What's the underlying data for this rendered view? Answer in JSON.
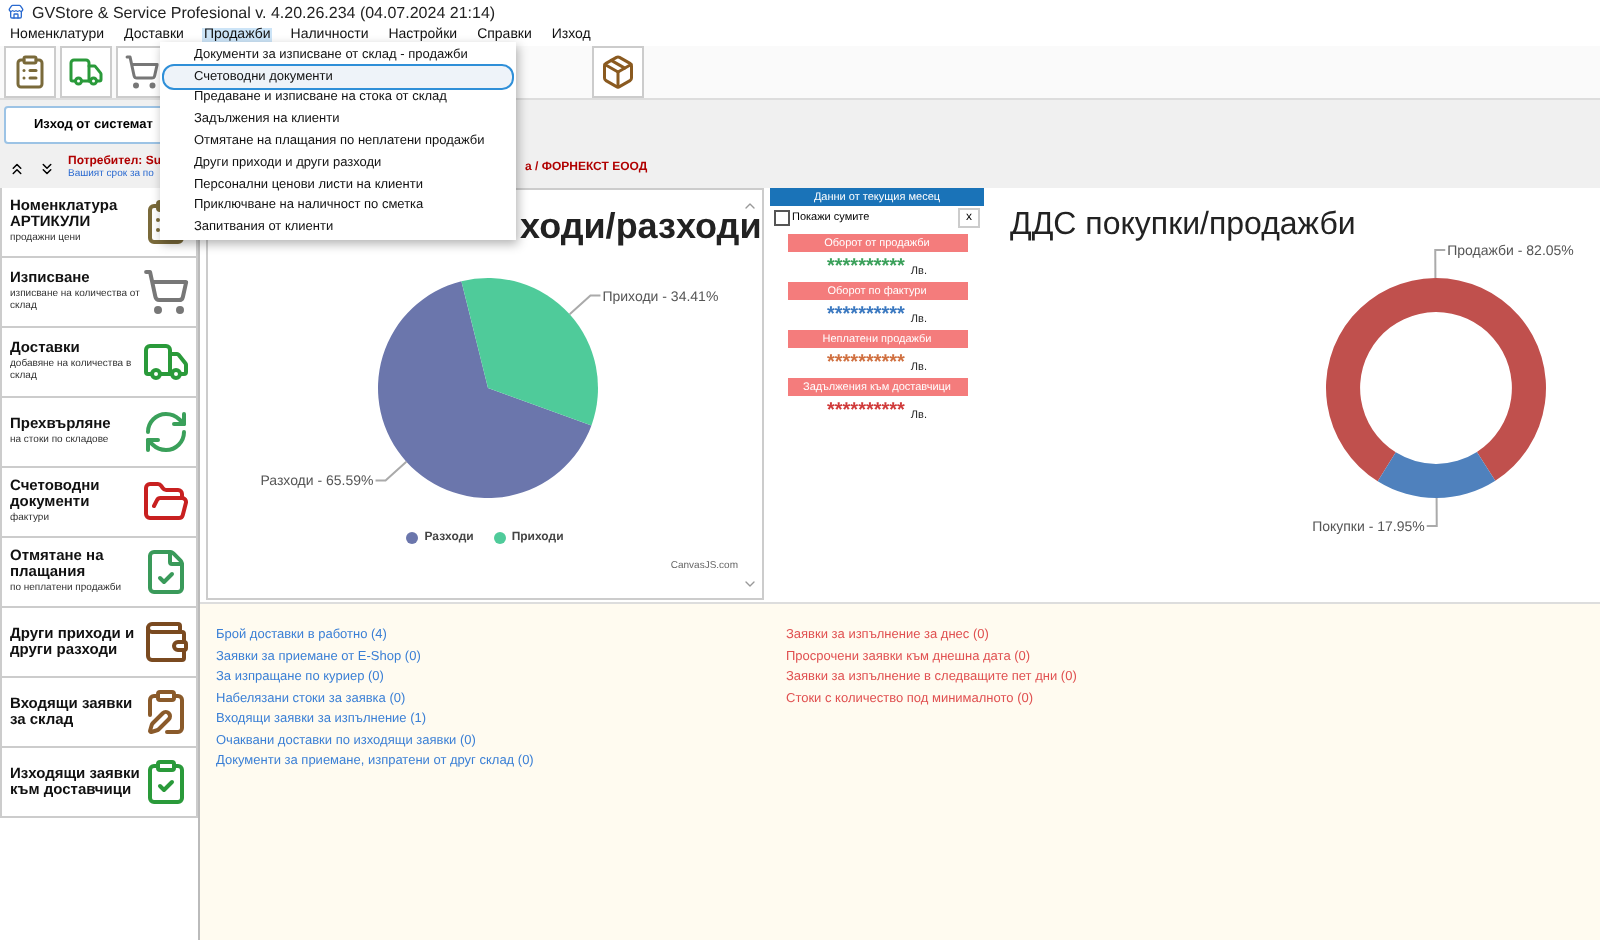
{
  "window": {
    "title": "GVStore & Service Profesional v. 4.20.26.234 (04.07.2024 21:14)"
  },
  "menu": [
    {
      "label": "Номенклатури",
      "selected": false
    },
    {
      "label": "Доставки",
      "selected": false
    },
    {
      "label": "Продажби",
      "selected": true
    },
    {
      "label": "Наличности",
      "selected": false
    },
    {
      "label": "Настройки",
      "selected": false
    },
    {
      "label": "Справки",
      "selected": false
    },
    {
      "label": "Изход",
      "selected": false
    }
  ],
  "dropdown": [
    {
      "label": "Документи за изписване от склад - продажби",
      "selected": false
    },
    {
      "label": "Счетоводни документи",
      "selected": true
    },
    {
      "label": "Предаване и изписване на стока от склад",
      "selected": false
    },
    {
      "label": "Задължения на клиенти",
      "selected": false
    },
    {
      "label": "Отмятане на плащания по неплатени продажби",
      "selected": false
    },
    {
      "label": "Други приходи и други разходи",
      "selected": false
    },
    {
      "label": "Персонални ценови листи на клиенти",
      "selected": false
    },
    {
      "label": "Приключване на наличност по сметка",
      "selected": false
    },
    {
      "label": "Запитвания от клиенти",
      "selected": false
    }
  ],
  "exit_button": "Изход от системат",
  "info": {
    "user": "Потребител: Su",
    "term": "Вашият срок за по",
    "company": "а / ФОРНЕКСТ ЕООД"
  },
  "sidebar": [
    {
      "title": "Номенклатура АРТИКУЛИ",
      "subtitle": "продажни цени"
    },
    {
      "title": "Изписване",
      "subtitle": "изписване на количества от склад"
    },
    {
      "title": "Доставки",
      "subtitle": "добавяне на количества в склад"
    },
    {
      "title": "Прехвърляне",
      "subtitle": "на стоки по складове"
    },
    {
      "title": "Счетоводни документи",
      "subtitle": "фактури"
    },
    {
      "title": "Отмятане на плащания",
      "subtitle": "по неплатени продажби"
    },
    {
      "title": "Други приходи и други разходи"
    },
    {
      "title": "Входящи заявки за склад"
    },
    {
      "title": "Изходящи заявки към доставчици"
    }
  ],
  "income_chart": {
    "chart_data": {
      "type": "pie",
      "title": "ходи/разходи",
      "categories": [
        "Разходи - 65.59%",
        "Приходи - 34.41%"
      ],
      "values": [
        65.59,
        34.41
      ],
      "colors": [
        "#6b76ac",
        "#4fcb9a"
      ]
    },
    "legend": [
      {
        "label": "Разходи",
        "color": "#6b76ac"
      },
      {
        "label": "Приходи",
        "color": "#4fcb9a"
      }
    ],
    "credit": "CanvasJS.com"
  },
  "month_panel": {
    "header": "Данни от текущия месец",
    "show_sums": {
      "label": "Покажи сумите",
      "checked": false
    },
    "close": "x",
    "items": [
      {
        "label": "Оборот от продажби",
        "value": "**********",
        "unit": "Лв.",
        "color": "#3aa05a"
      },
      {
        "label": "Оборот по фактури",
        "value": "**********",
        "unit": "Лв.",
        "color": "#3a78c0"
      },
      {
        "label": "Неплатени продажби",
        "value": "**********",
        "unit": "Лв.",
        "color": "#d07040"
      },
      {
        "label": "Задължения към доставчици",
        "value": "**********",
        "unit": "Лв.",
        "color": "#d03a3a"
      }
    ]
  },
  "vat_chart": {
    "chart_data": {
      "type": "donut",
      "title": "ДДС покупки/продажби",
      "categories": [
        "Продажби - 82.05%",
        "Покупки - 17.95%"
      ],
      "values": [
        82.05,
        17.95
      ],
      "colors": [
        "#c0504d",
        "#4f81bd"
      ]
    }
  },
  "links_left": [
    "Брой доставки в работно (4)",
    "Заявки за приемане от E-Shop (0)",
    "За изпращане по куриер (0)",
    "Набелязани стоки за заявка (0)",
    "Входящи заявки за изпълнение (1)",
    "Очаквани доставки по изходящи заявки (0)",
    "Документи за приемане, изпратени от друг склад (0)"
  ],
  "links_right": [
    "Заявки за изпълнение за днес (0)",
    "Просрочени заявки към днешна дата (0)",
    "Заявки за изпълнение в следващите пет дни (0)",
    "Стоки с количество под минималното (0)"
  ]
}
